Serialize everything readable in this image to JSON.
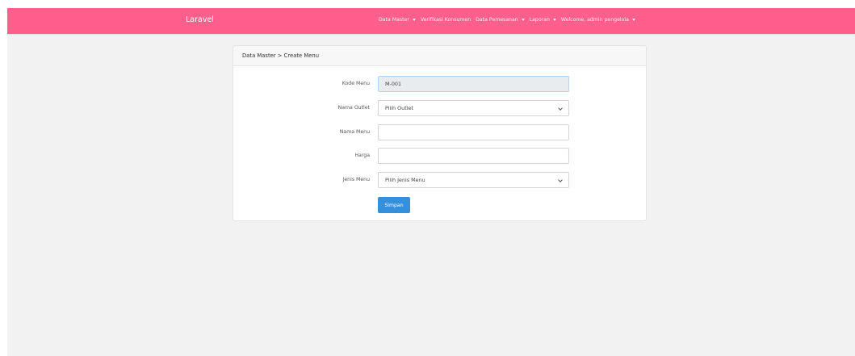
{
  "navbar": {
    "brand": "Laravel",
    "items": [
      {
        "label": "Data Master",
        "dropdown": true
      },
      {
        "label": "Verifikasi Konsumen",
        "dropdown": false
      },
      {
        "label": "Data Pemesanan",
        "dropdown": true
      },
      {
        "label": "Laporan",
        "dropdown": true
      },
      {
        "label": "Welcome, admin pengelola",
        "dropdown": true
      }
    ],
    "color": "#ff5f8c"
  },
  "card": {
    "header": "Data Master > Create Menu"
  },
  "form": {
    "kode_menu": {
      "label": "Kode Menu",
      "value": "M-001",
      "readonly": true
    },
    "nama_outlet": {
      "label": "Nama Outlet",
      "selected": "Pilih Outlet"
    },
    "nama_menu": {
      "label": "Nama Menu",
      "value": ""
    },
    "harga": {
      "label": "Harga",
      "value": ""
    },
    "jenis_menu": {
      "label": "Jenis Menu",
      "selected": "Pilih Jenis Menu"
    },
    "submit_label": "Simpan",
    "button_color": "#3490dc"
  }
}
